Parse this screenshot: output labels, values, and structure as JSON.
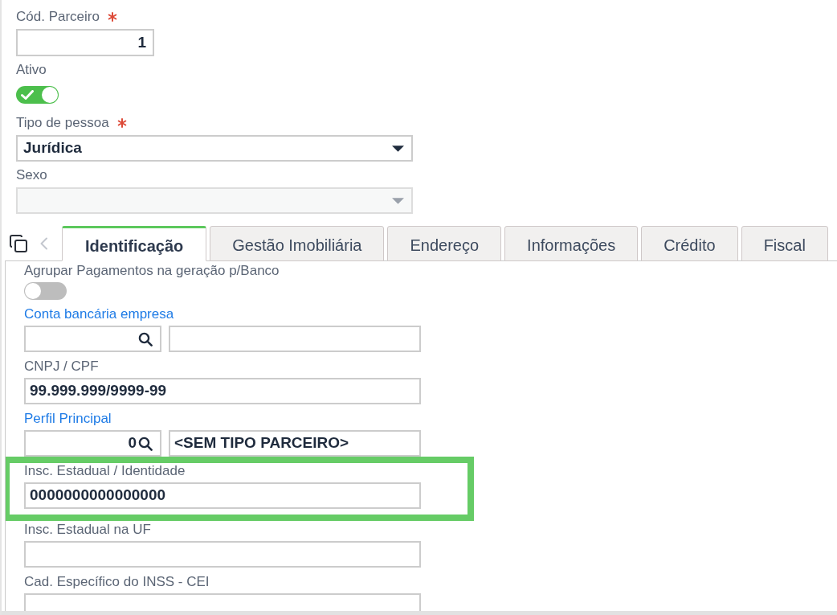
{
  "header_fields": [
    {
      "kind": "input",
      "label": "Cód. Parceiro",
      "required": true,
      "value": "1"
    },
    {
      "kind": "toggle",
      "label": "Ativo",
      "required": false,
      "on": true
    },
    {
      "kind": "select",
      "label": "Tipo de pessoa",
      "required": true,
      "value": "Jurídica",
      "disabled": false
    },
    {
      "kind": "select",
      "label": "Sexo",
      "required": false,
      "disabled": true
    }
  ],
  "tabs": [
    {
      "label": "Identificação",
      "selected": true
    },
    {
      "label": "Gestão Imobiliária",
      "selected": false
    },
    {
      "label": "Endereço",
      "selected": false
    },
    {
      "label": "Informações",
      "selected": false
    },
    {
      "label": "Crédito",
      "selected": false
    },
    {
      "label": "Fiscal",
      "selected": false
    }
  ],
  "tab_panel": {
    "fields": [
      {
        "kind": "toggle",
        "label": "Agrupar Pagamentos na geração p/Banco",
        "link": false,
        "highlighted": false,
        "on": false
      },
      {
        "kind": "lookup",
        "label": "Conta bancária empresa",
        "link": true,
        "highlighted": false
      },
      {
        "kind": "text",
        "label": "CNPJ / CPF",
        "link": false,
        "highlighted": false,
        "value": "99.999.999/9999-99"
      },
      {
        "kind": "lookup",
        "label": "Perfil Principal",
        "link": true,
        "highlighted": false,
        "code": "0",
        "description": "<SEM TIPO PARCEIRO>"
      },
      {
        "kind": "text",
        "label": "Insc. Estadual / Identidade",
        "link": false,
        "highlighted": true,
        "value": "0000000000000000"
      },
      {
        "kind": "text",
        "label": "Insc. Estadual na UF",
        "link": false,
        "highlighted": false
      },
      {
        "kind": "text",
        "label": "Cad. Específico do INSS - CEI",
        "link": false,
        "highlighted": false
      }
    ]
  }
}
